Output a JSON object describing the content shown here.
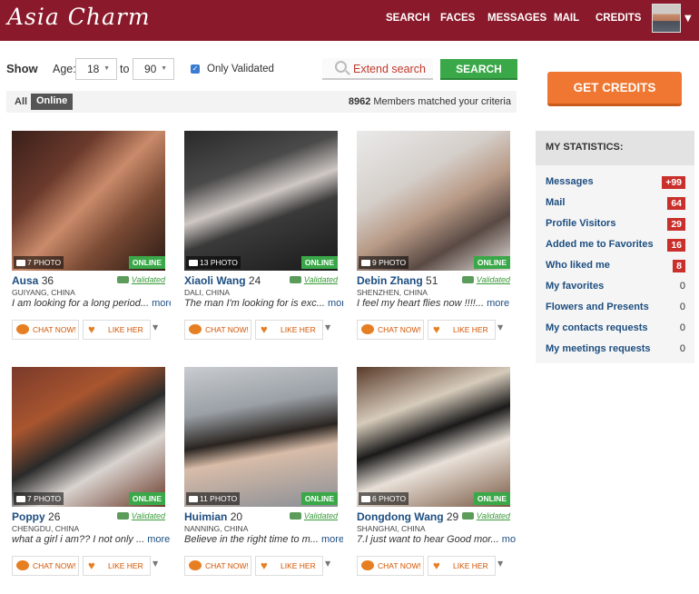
{
  "brand": {
    "logo": "Asia Charm"
  },
  "nav": {
    "items": [
      "SEARCH",
      "FACES",
      "MESSAGES",
      "MAIL",
      "CREDITS"
    ]
  },
  "search": {
    "show_label": "Show",
    "age_label": "Age:",
    "age_from": "18",
    "to_label": "to",
    "age_to": "90",
    "only_validated": "Only Validated",
    "only_validated_checked": true,
    "extend_search": "Extend search",
    "search_button": "SEARCH"
  },
  "filter": {
    "all": "All",
    "online": "Online",
    "count": "8962",
    "matched_text": "Members matched your criteria"
  },
  "profiles": [
    {
      "name": "Ausa",
      "age": "36",
      "city": "GUIYANG, CHINA",
      "desc": "I am looking for a long period...",
      "photos": "7 PHOTO",
      "status": "ONLINE",
      "validated": "Validated"
    },
    {
      "name": "Xiaoli Wang",
      "age": "24",
      "city": "DALI, CHINA",
      "desc": "The man I'm looking for is exc...",
      "photos": "13 PHOTO",
      "status": "ONLINE",
      "validated": "Validated"
    },
    {
      "name": "Debin Zhang",
      "age": "51",
      "city": "SHENZHEN, CHINA",
      "desc": "I feel my heart flies now !!!!...",
      "photos": "9 PHOTO",
      "status": "ONLINE",
      "validated": "Validated"
    },
    {
      "name": "Poppy",
      "age": "26",
      "city": "CHENGDU, CHINA",
      "desc": "what a girl i am?? I not only ...",
      "photos": "7 PHOTO",
      "status": "ONLINE",
      "validated": "Validated"
    },
    {
      "name": "Huimian",
      "age": "20",
      "city": "NANNING, CHINA",
      "desc": "Believe in the right time to m...",
      "photos": "11 PHOTO",
      "status": "ONLINE",
      "validated": "Validated"
    },
    {
      "name": "Dongdong Wang",
      "age": "29",
      "city": "SHANGHAI, CHINA",
      "desc": "7.I just want to hear Good mor...",
      "photos": "6 PHOTO",
      "status": "ONLINE",
      "validated": "Validated"
    }
  ],
  "card_actions": {
    "more": "more",
    "chat": "CHAT NOW!",
    "like": "LIKE HER"
  },
  "sidebar": {
    "get_credits": "GET CREDITS",
    "stats_title": "MY STATISTICS:",
    "stats": [
      {
        "label": "Messages",
        "count": "+99",
        "highlight": true
      },
      {
        "label": "Mail",
        "count": "64",
        "highlight": true
      },
      {
        "label": "Profile Visitors",
        "count": "29",
        "highlight": true
      },
      {
        "label": "Added me to Favorites",
        "count": "16",
        "highlight": true
      },
      {
        "label": "Who liked me",
        "count": "8",
        "highlight": true
      },
      {
        "label": "My favorites",
        "count": "0",
        "highlight": false
      },
      {
        "label": "Flowers and Presents",
        "count": "0",
        "highlight": false
      },
      {
        "label": "My contacts requests",
        "count": "0",
        "highlight": false
      },
      {
        "label": "My meetings requests",
        "count": "0",
        "highlight": false
      }
    ]
  },
  "colors": {
    "header": "#8a1a2b",
    "accent_green": "#3aa849",
    "accent_orange": "#ef7731",
    "link_blue": "#1d4e80",
    "badge_red": "#c9302c"
  }
}
